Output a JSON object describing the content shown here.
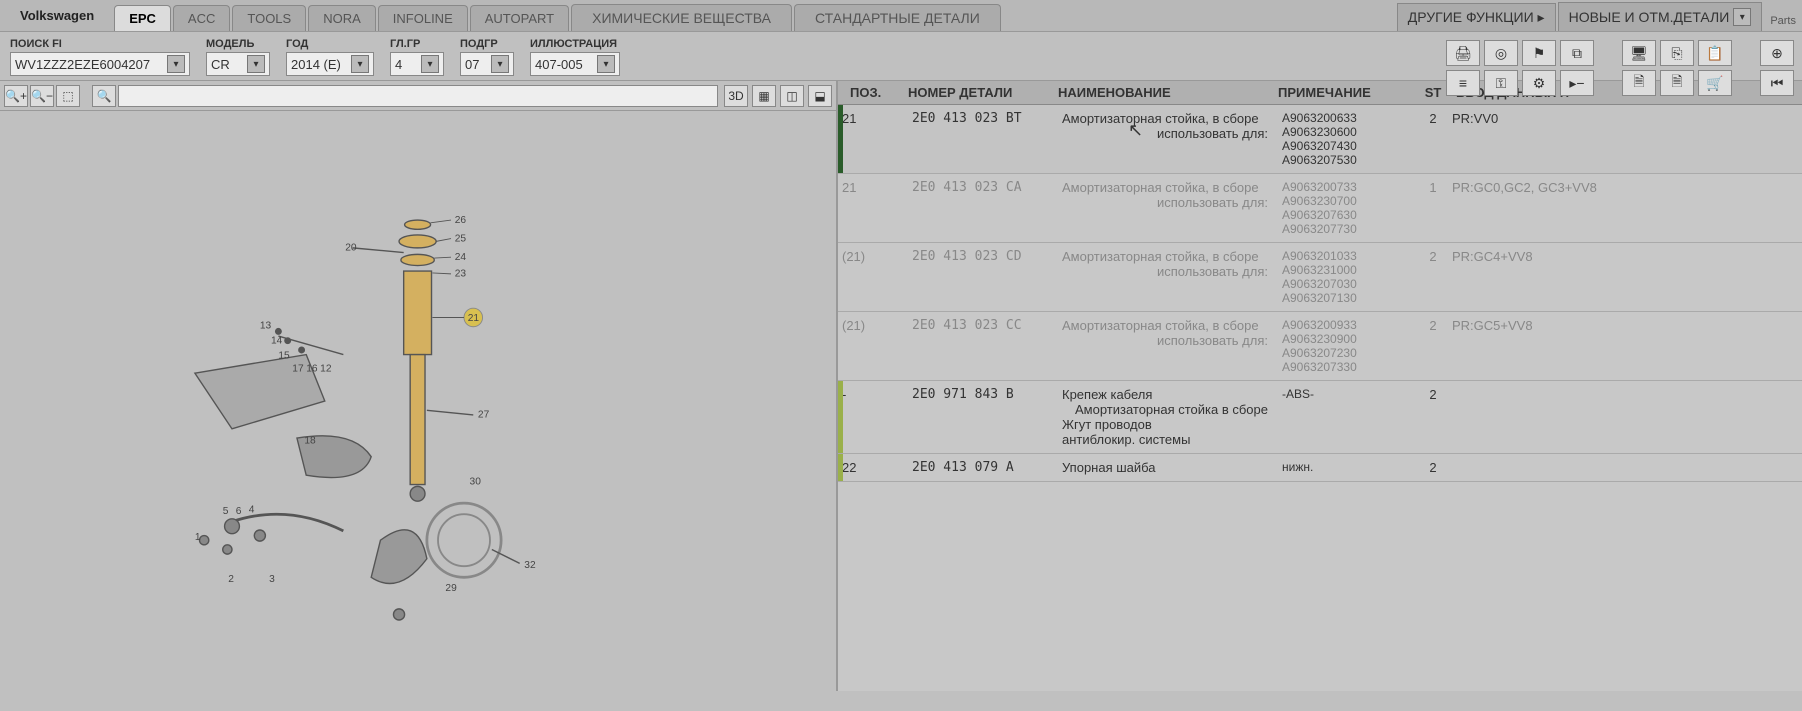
{
  "brand": "Volkswagen",
  "tabs": [
    "EPC",
    "ACC",
    "TOOLS",
    "NORA",
    "INFOLINE",
    "AUTOPART",
    "ХИМИЧЕСКИЕ ВЕЩЕСТВА",
    "СТАНДАРТНЫЕ ДЕТАЛИ"
  ],
  "active_tab": 0,
  "right_tabs": [
    "ДРУГИЕ ФУНКЦИИ ▸",
    "НОВЫЕ И ОТМ.ДЕТАЛИ"
  ],
  "parts_label": "Parts",
  "filters": {
    "search": {
      "label": "ПОИСК FI",
      "value": "WV1ZZZ2EZE6004207"
    },
    "model": {
      "label": "МОДЕЛЬ",
      "value": "CR"
    },
    "year": {
      "label": "ГОД",
      "value": "2014 (E)"
    },
    "glgr": {
      "label": "ГЛ.ГР",
      "value": "4"
    },
    "podgr": {
      "label": "ПОДГР",
      "value": "07"
    },
    "illus": {
      "label": "ИЛЛЮСТРАЦИЯ",
      "value": "407-005"
    }
  },
  "zoom_label_3d": "3D",
  "columns": {
    "pos": "ПОЗ.",
    "part": "НОМЕР ДЕТАЛИ",
    "name": "НАИМЕНОВАНИЕ",
    "note": "ПРИМЕЧАНИЕ",
    "st": "ST",
    "data": "ВВОД ДАННЫХ П"
  },
  "rows": [
    {
      "pos": "21",
      "part": "2E0 413 023 BT",
      "name": "Амортизаторная стойка, в сборе",
      "name2": "использовать для:",
      "notes": [
        "A9063200633",
        "A9063230600",
        "A9063207430",
        "A9063207530"
      ],
      "st": "2",
      "data": "PR:VV0",
      "selected": true
    },
    {
      "pos": "21",
      "part": "2E0 413 023 CA",
      "name": "Амортизаторная стойка, в сборе",
      "name2": "использовать для:",
      "notes": [
        "A9063200733",
        "A9063230700",
        "A9063207630",
        "A9063207730"
      ],
      "st": "1",
      "data": "PR:GC0,GC2, GC3+VV8",
      "faded": true
    },
    {
      "pos": "(21)",
      "part": "2E0 413 023 CD",
      "name": "Амортизаторная стойка, в сборе",
      "name2": "использовать для:",
      "notes": [
        "A9063201033",
        "A9063231000",
        "A9063207030",
        "A9063207130"
      ],
      "st": "2",
      "data": "PR:GC4+VV8",
      "faded": true
    },
    {
      "pos": "(21)",
      "part": "2E0 413 023 CC",
      "name": "Амортизаторная стойка, в сборе",
      "name2": "использовать для:",
      "notes": [
        "A9063200933",
        "A9063230900",
        "A9063207230",
        "A9063207330"
      ],
      "st": "2",
      "data": "PR:GC5+VV8",
      "faded": true
    },
    {
      "pos": "-",
      "part": "2E0 971 843 B",
      "name": "Крепеж кабеля",
      "name2": "Амортизаторная стойка в сборе",
      "name3": "Жгут проводов",
      "name4": "антиблокир. системы",
      "note_extra": "-ABS-",
      "notes": [],
      "st": "2",
      "data": "",
      "green": true
    },
    {
      "pos": "22",
      "part": "2E0 413 079 A",
      "name": "Упорная шайба",
      "name2": "",
      "note_extra": "нижн.",
      "notes": [],
      "st": "2",
      "data": "",
      "green": true
    }
  ],
  "callouts": [
    "20",
    "26",
    "25",
    "24",
    "23",
    "21",
    "13",
    "14",
    "15",
    "17",
    "16",
    "12",
    "18",
    "5",
    "6",
    "4",
    "2",
    "3",
    "1",
    "27",
    "30",
    "29",
    "32"
  ]
}
